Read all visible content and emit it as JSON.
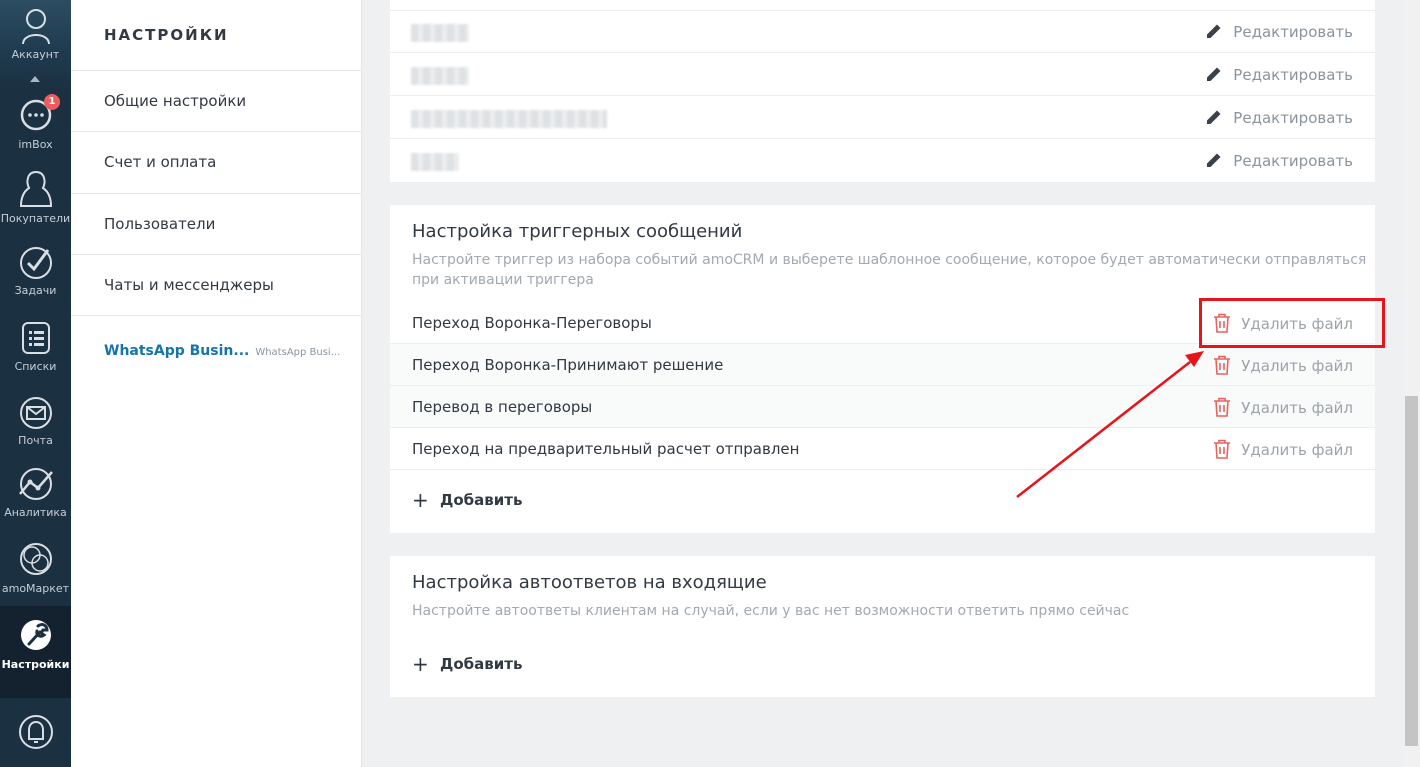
{
  "rail": {
    "account": "Аккаунт",
    "imbox": "imBox",
    "imbox_badge": "1",
    "customers": "Покупатели",
    "tasks": "Задачи",
    "lists": "Списки",
    "mail": "Почта",
    "analytics": "Аналитика",
    "market": "amoМаркет",
    "settings": "Настройки"
  },
  "nav": {
    "title": "НАСТРОЙКИ",
    "items": [
      {
        "label": "Общие настройки"
      },
      {
        "label": "Счет и оплата"
      },
      {
        "label": "Пользователи"
      },
      {
        "label": "Чаты и мессенджеры"
      }
    ],
    "sub_item": {
      "label": "WhatsApp Busin...",
      "hint": "WhatsApp Busi..."
    }
  },
  "templates": {
    "edit_label": "Редактировать"
  },
  "triggers": {
    "title": "Настройка триггерных сообщений",
    "description": "Настройте триггер из набора событий amoCRM и выберете шаблонное сообщение, которое будет автоматически отправляться при активации триггера",
    "items": [
      {
        "label": "Переход Воронка-Переговоры"
      },
      {
        "label": "Переход Воронка-Принимают решение"
      },
      {
        "label": "Перевод в переговоры"
      },
      {
        "label": "Переход на предварительный расчет отправлен"
      }
    ],
    "delete_label": "Удалить файл",
    "add_label": "Добавить"
  },
  "autoreplies": {
    "title": "Настройка автоответов на входящие",
    "description": "Настройте автоответы клиентам на случай, если у вас нет возможности ответить прямо сейчас",
    "add_label": "Добавить"
  },
  "colors": {
    "rail_bg": "#1b3041",
    "link_blue": "#1375ab",
    "delete_red": "#e8625e",
    "annotation_red": "#e8141c",
    "badge_red": "#f05b5b"
  }
}
